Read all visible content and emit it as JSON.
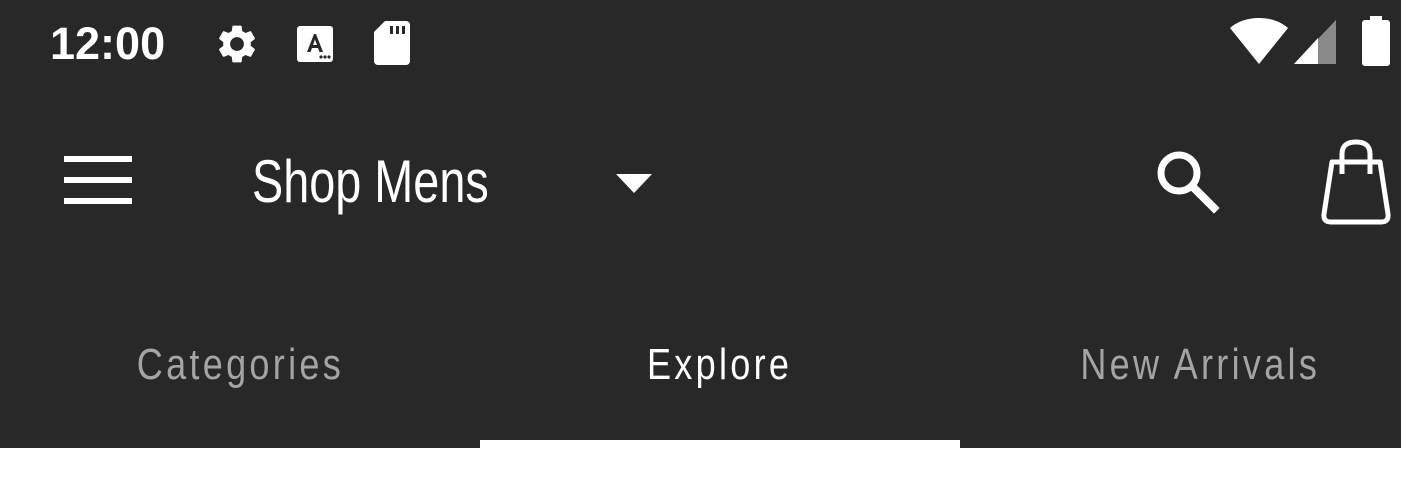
{
  "status_bar": {
    "time": "12:00",
    "icons": [
      "gear-icon",
      "accessibility-a-icon",
      "sd-card-icon",
      "wifi-icon",
      "signal-icon",
      "battery-icon"
    ]
  },
  "toolbar": {
    "title": "Shop Mens",
    "icons": [
      "menu-icon",
      "dropdown-arrow-icon",
      "search-icon",
      "shopping-bag-icon"
    ]
  },
  "tabs": [
    {
      "label": "Categories",
      "active": false
    },
    {
      "label": "Explore",
      "active": true
    },
    {
      "label": "New Arrivals",
      "active": false
    }
  ],
  "colors": {
    "header_bg": "#282828",
    "active_text": "#ffffff",
    "inactive_text": "#a4a4a4",
    "page_bg": "#ffffff"
  }
}
